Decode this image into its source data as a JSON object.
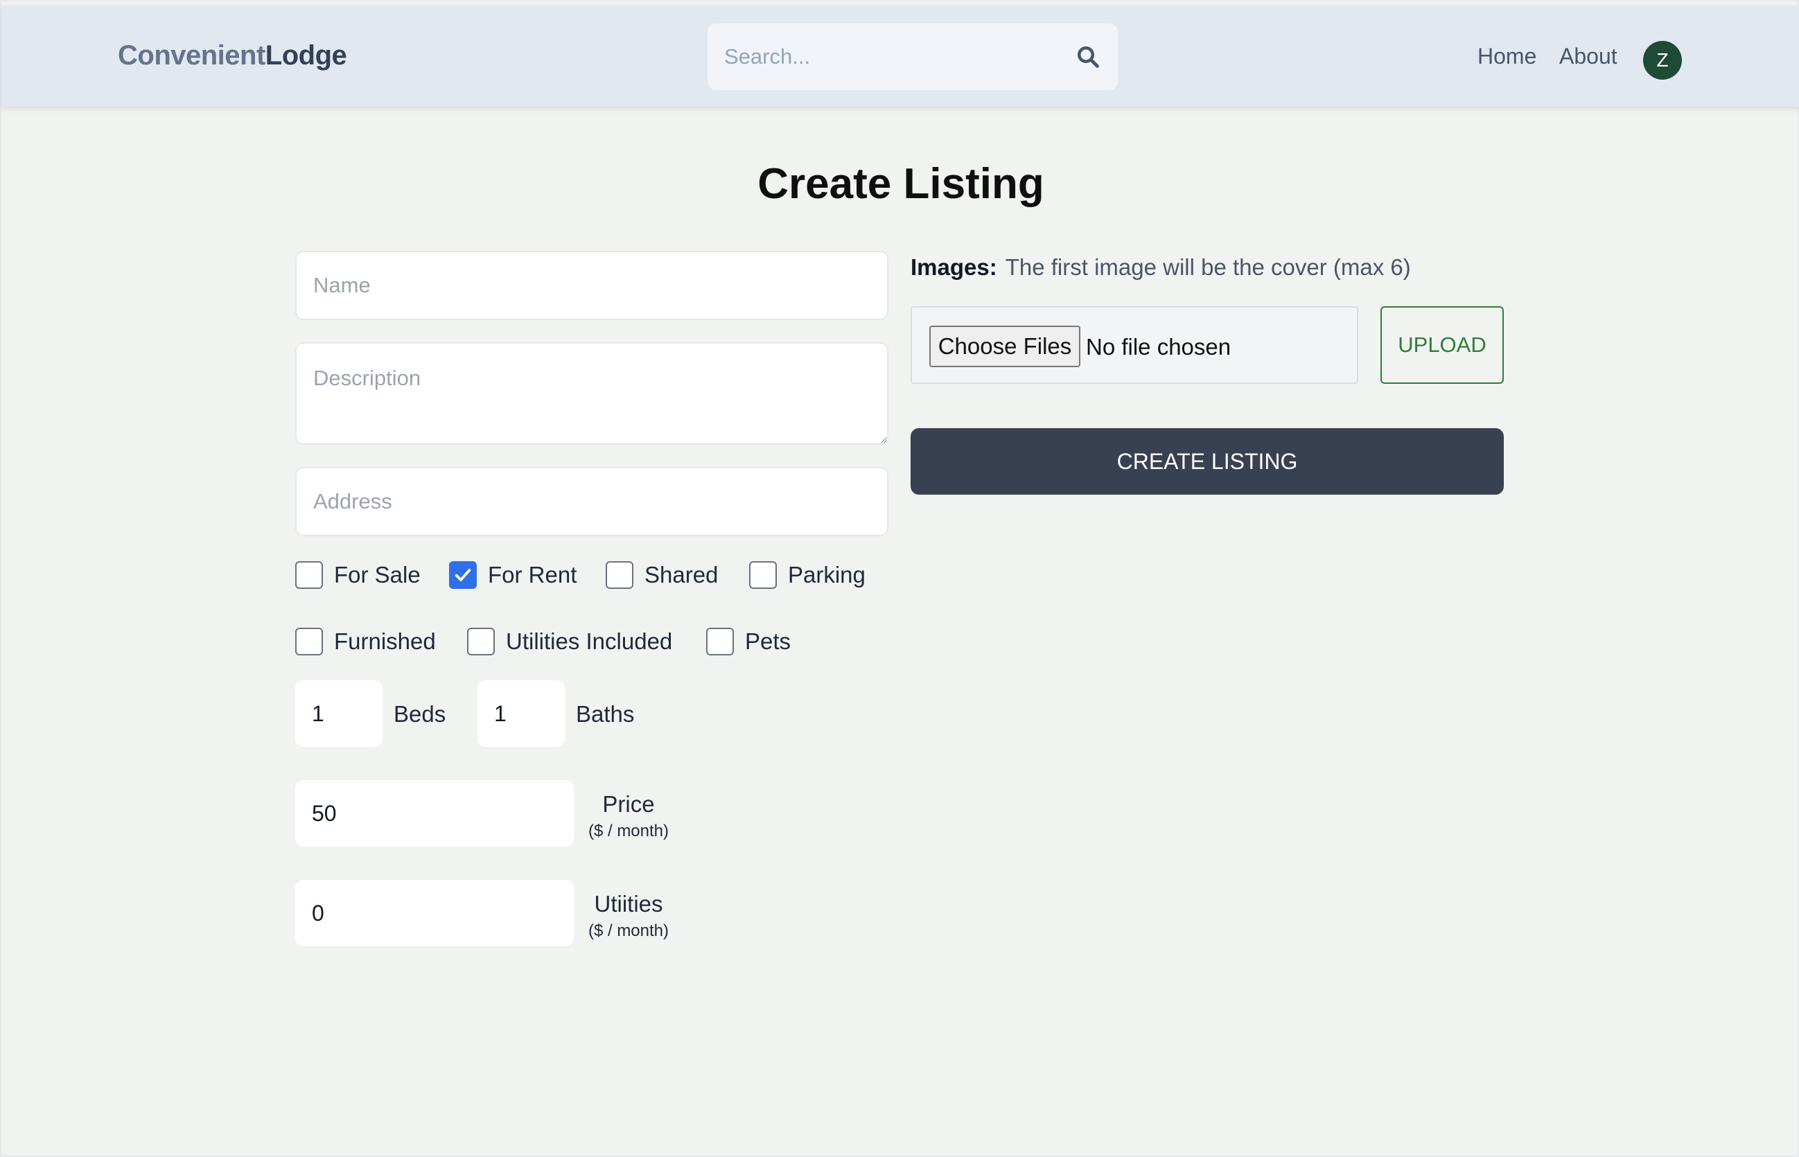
{
  "header": {
    "logo_part1": "Convenient",
    "logo_part2": "Lodge",
    "search_placeholder": "Search...",
    "nav": {
      "home": "Home",
      "about": "About"
    },
    "avatar_initial": "Z",
    "search_icon": "search-icon"
  },
  "page_title": "Create Listing",
  "form": {
    "name_placeholder": "Name",
    "description_placeholder": "Description",
    "address_placeholder": "Address",
    "checkboxes": [
      {
        "label": "For Sale",
        "checked": false
      },
      {
        "label": "For Rent",
        "checked": true
      },
      {
        "label": "Shared",
        "checked": false
      },
      {
        "label": "Parking",
        "checked": false
      },
      {
        "label": "Furnished",
        "checked": false
      },
      {
        "label": "Utilities Included",
        "checked": false
      },
      {
        "label": "Pets",
        "checked": false
      }
    ],
    "beds_value": "1",
    "beds_label": "Beds",
    "baths_value": "1",
    "baths_label": "Baths",
    "price_value": "50",
    "price_label": "Price",
    "price_unit": "($ / month)",
    "utilities_value": "0",
    "utilities_label": "Utiities",
    "utilities_unit": "($ / month)"
  },
  "images": {
    "label": "Images:",
    "hint": "The first image will be the cover (max 6)",
    "choose_files": "Choose Files",
    "no_file": "No file chosen",
    "upload": "UPLOAD"
  },
  "submit_label": "CREATE LISTING",
  "colors": {
    "header_bg": "#e2e8f0",
    "page_bg": "#f1f3f1",
    "avatar_bg": "#1e4a38",
    "checkbox_accent": "#2f6fe8",
    "upload_green": "#2e7d3a",
    "submit_bg": "#374151"
  }
}
